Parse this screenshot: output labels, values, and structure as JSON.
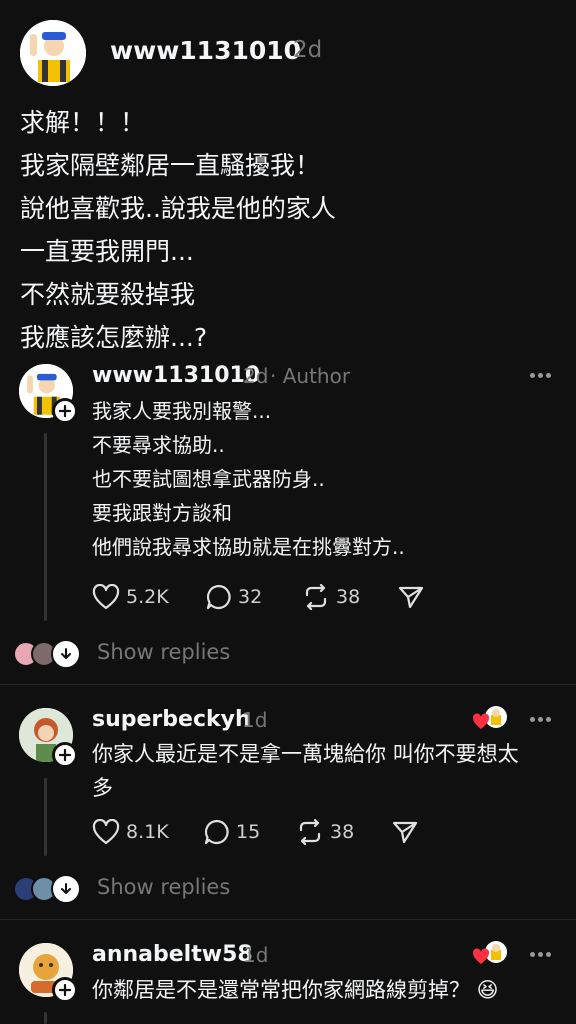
{
  "post": {
    "username": "www1131010",
    "time": "2d",
    "lines": [
      "求解！！！",
      "我家隔壁鄰居一直騷擾我！",
      "說他喜歡我..說我是他的家人",
      "一直要我開門...",
      "不然就要殺掉我",
      "我應該怎麼辦...?"
    ]
  },
  "replies": [
    {
      "username": "www1131010",
      "time": "2d",
      "tag": "· Author",
      "lines": [
        "我家人要我別報警...",
        "不要尋求協助..",
        "也不要試圖想拿武器防身..",
        "要我跟對方談和",
        "他們說我尋求協助就是在挑釁對方.."
      ],
      "likes": "5.2K",
      "comments": "32",
      "reposts": "38",
      "show_replies": "Show replies"
    },
    {
      "username": "superbeckyh",
      "time": "1d",
      "lines": [
        "你家人最近是不是拿一萬塊給你 叫你不要想太",
        "多"
      ],
      "likes": "8.1K",
      "comments": "15",
      "reposts": "38",
      "show_replies": "Show replies"
    },
    {
      "username": "annabeltw58",
      "time": "1d",
      "lines": [
        "你鄰居是不是還常常把你家網路線剪掉？ 😆"
      ]
    }
  ],
  "colors": {
    "background": "#101010",
    "text": "#f3f5f7",
    "muted": "#777777",
    "like_heart": "#ff3040"
  }
}
